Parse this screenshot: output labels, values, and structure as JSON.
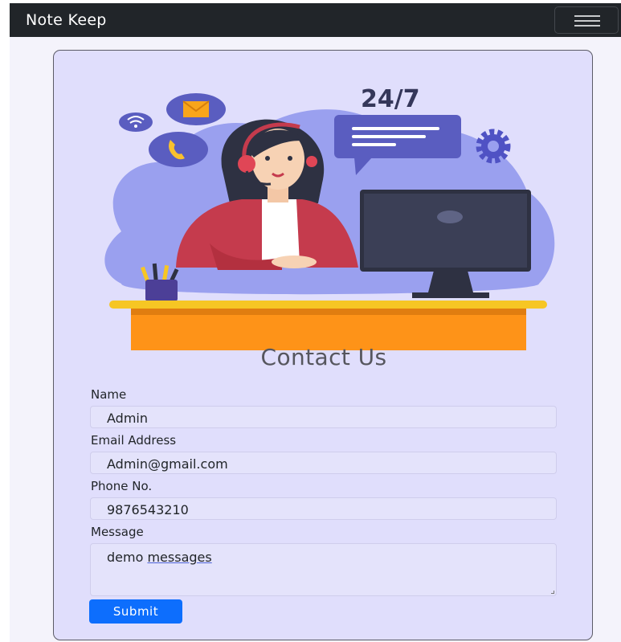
{
  "navbar": {
    "brand": "Note Keep",
    "toggler_icon": "hamburger-menu-icon"
  },
  "illustration": {
    "badge_text": "24/7",
    "icons": [
      "wifi-icon",
      "mail-icon",
      "phone-icon",
      "chat-bubble-icon",
      "gear-icon",
      "pencil-cup-icon",
      "monitor-icon",
      "headset-agent-icon"
    ],
    "colors": {
      "blob": "#9aa0ef",
      "desk": "#fe9318",
      "desk_top": "#f6c624",
      "jacket": "#c53b4d"
    }
  },
  "form": {
    "title": "Contact Us",
    "fields": {
      "name": {
        "label": "Name",
        "value": "Admin"
      },
      "email": {
        "label": "Email Address",
        "value": "Admin@gmail.com"
      },
      "phone": {
        "label": "Phone No.",
        "value": "9876543210"
      },
      "message": {
        "label": "Message",
        "value_word1": "demo",
        "value_word2": "messages"
      }
    },
    "submit_label": "Submit"
  },
  "colors": {
    "navbar": "#212529",
    "card_bg": "#e0defc",
    "primary": "#0d6efd"
  }
}
